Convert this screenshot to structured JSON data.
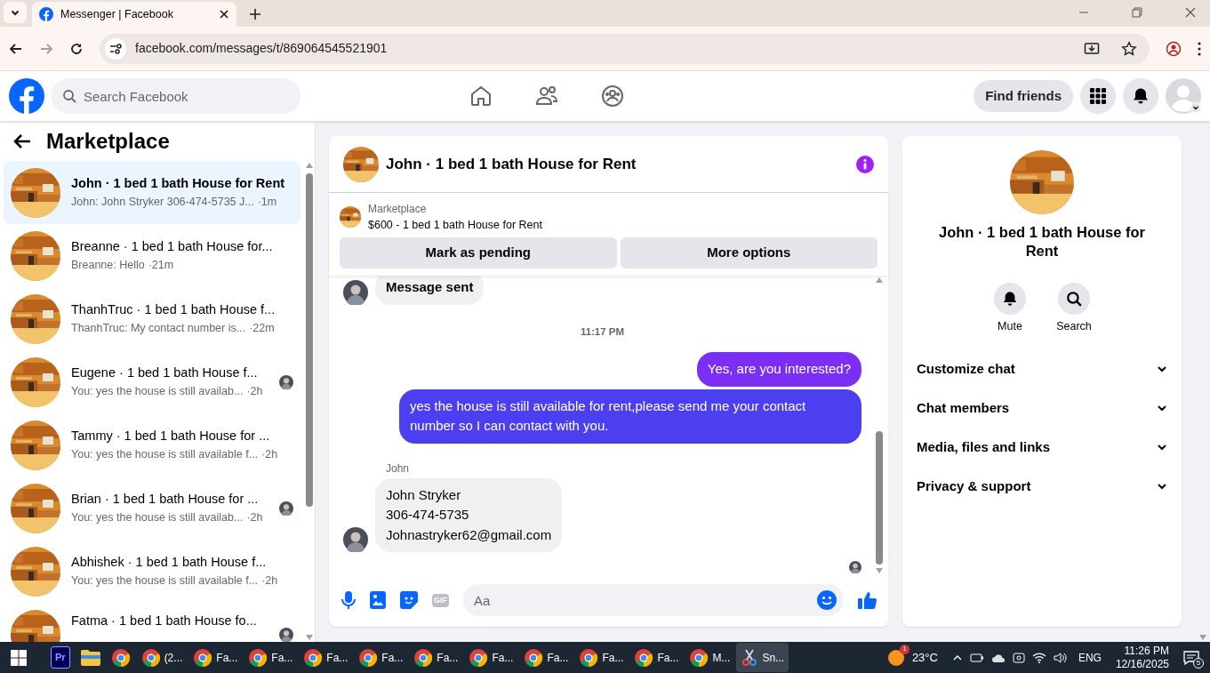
{
  "browser": {
    "tab_title": "Messenger | Facebook",
    "url": "facebook.com/messages/t/869064545521901"
  },
  "topbar": {
    "search_placeholder": "Search Facebook",
    "find_friends": "Find friends"
  },
  "sidebar": {
    "title": "Marketplace",
    "conversations": [
      {
        "name": "John · 1 bed 1 bath House for Rent",
        "preview": "John: John Stryker 306-474-5735 J...",
        "time": "·1m",
        "selected": true,
        "read_avatar": false
      },
      {
        "name": "Breanne · 1 bed 1 bath House for...",
        "preview": "Breanne: Hello",
        "time": "·21m",
        "selected": false,
        "read_avatar": false
      },
      {
        "name": "ThanhTruc · 1 bed 1 bath House f...",
        "preview": "ThanhTruc: My contact number is...",
        "time": "·22m",
        "selected": false,
        "read_avatar": false
      },
      {
        "name": "Eugene · 1 bed 1 bath House f...",
        "preview": "You: yes the house is still availab...",
        "time": "·2h",
        "selected": false,
        "read_avatar": true
      },
      {
        "name": "Tammy · 1 bed 1 bath House for ...",
        "preview": "You: yes the house is still available f...",
        "time": "·2h",
        "selected": false,
        "read_avatar": false
      },
      {
        "name": "Brian · 1 bed 1 bath House for ...",
        "preview": "You: yes the house is still availab...",
        "time": "·2h",
        "selected": false,
        "read_avatar": true
      },
      {
        "name": "Abhishek · 1 bed 1 bath House f...",
        "preview": "You: yes the house is still available f...",
        "time": "·2h",
        "selected": false,
        "read_avatar": false
      },
      {
        "name": "Fatma · 1 bed 1 bath House fo...",
        "selected": false,
        "read_avatar": true
      }
    ]
  },
  "chat": {
    "title": "John · 1 bed 1 bath House for Rent",
    "listing": {
      "label": "Marketplace",
      "title": "$600 - 1 bed 1 bath House for Rent"
    },
    "actions": [
      "Mark as pending",
      "More options"
    ],
    "messages": [
      {
        "kind": "incoming",
        "text": "Message sent",
        "bold": true
      },
      {
        "kind": "timestamp",
        "text": "11:17 PM"
      },
      {
        "kind": "outgoing",
        "text": "Yes, are you interested?"
      },
      {
        "kind": "outgoing",
        "text": "yes the house is still available for rent,please send me your contact number so I can contact with you."
      },
      {
        "kind": "sender",
        "text": "John"
      },
      {
        "kind": "incoming",
        "text": "John Stryker\n306-474-5735\nJohnastryker62@gmail.com",
        "bold": false
      }
    ],
    "composer": {
      "gif_label": "GIF",
      "placeholder": "Aa"
    }
  },
  "info": {
    "title": "John · 1 bed 1 bath House for Rent",
    "actions": [
      {
        "kind": "mute",
        "label": "Mute"
      },
      {
        "kind": "search",
        "label": "Search"
      }
    ],
    "sections": [
      "Customize chat",
      "Chat members",
      "Media, files and links",
      "Privacy & support"
    ]
  },
  "taskbar": {
    "apps": [
      {
        "kind": "premiere",
        "label": "Pr",
        "selected": false
      },
      {
        "kind": "files",
        "selected": false
      },
      {
        "kind": "chrome",
        "selected": false
      },
      {
        "kind": "chrome",
        "label": "(2...",
        "selected": false
      },
      {
        "kind": "chrome",
        "label": "Fa...",
        "selected": false
      },
      {
        "kind": "chrome",
        "label": "Fa...",
        "selected": false
      },
      {
        "kind": "chrome",
        "label": "Fa...",
        "selected": false
      },
      {
        "kind": "chrome",
        "label": "Fa...",
        "selected": false
      },
      {
        "kind": "chrome",
        "label": "Fa...",
        "selected": false
      },
      {
        "kind": "chrome",
        "label": "Fa...",
        "selected": false
      },
      {
        "kind": "chrome",
        "label": "Fa...",
        "selected": false
      },
      {
        "kind": "chrome",
        "label": "Fa...",
        "selected": false
      },
      {
        "kind": "chrome",
        "label": "Fa...",
        "selected": false
      },
      {
        "kind": "chrome",
        "label": "M...",
        "selected": false
      },
      {
        "kind": "snip",
        "label": "Sn...",
        "selected": true
      }
    ],
    "weather": {
      "badge": "1",
      "temp": "23°C"
    },
    "lang": "ENG",
    "time": "11:26 PM",
    "date": "12/16/2025",
    "notifications": "5"
  }
}
